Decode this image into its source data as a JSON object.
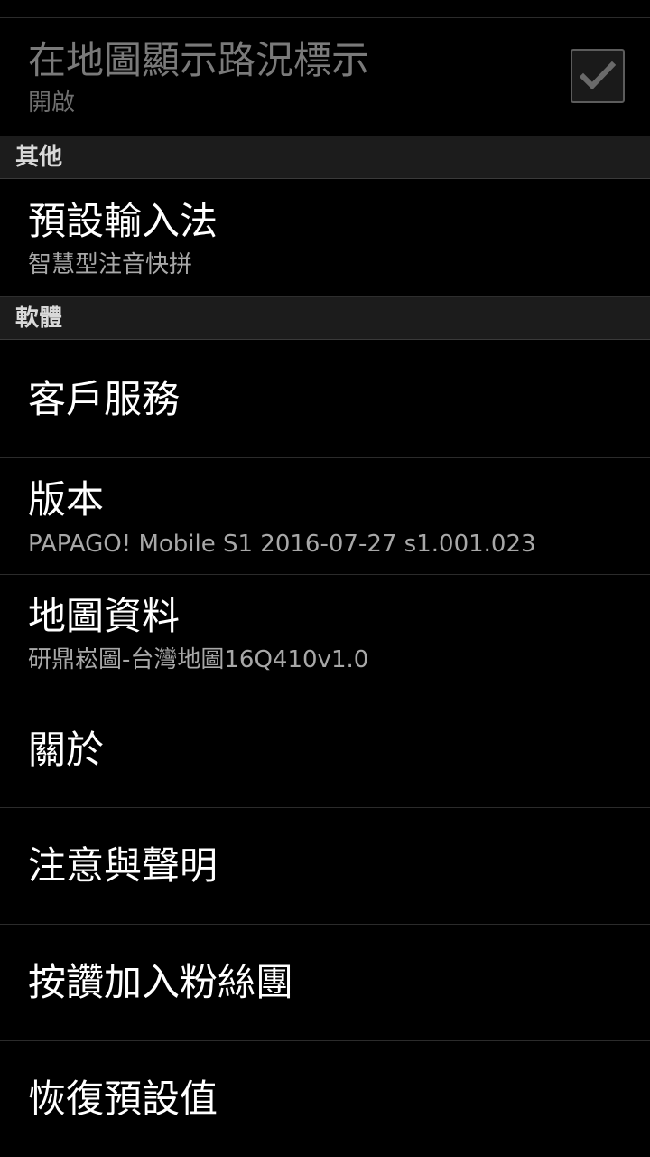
{
  "traffic": {
    "title": "在地圖顯示路況標示",
    "summary": "開啟",
    "checked": true
  },
  "sections": {
    "other": "其他",
    "software": "軟體"
  },
  "ime": {
    "title": "預設輸入法",
    "summary": "智慧型注音快拼"
  },
  "customer_service": {
    "title": "客戶服務"
  },
  "version": {
    "title": "版本",
    "summary": "PAPAGO! Mobile S1 2016-07-27 s1.001.023"
  },
  "map_data": {
    "title": "地圖資料",
    "summary": "研鼎崧圖-台灣地圖16Q410v1.0"
  },
  "about": {
    "title": "關於"
  },
  "notice": {
    "title": "注意與聲明"
  },
  "fan_club": {
    "title": "按讚加入粉絲團"
  },
  "restore": {
    "title": "恢復預設值"
  }
}
